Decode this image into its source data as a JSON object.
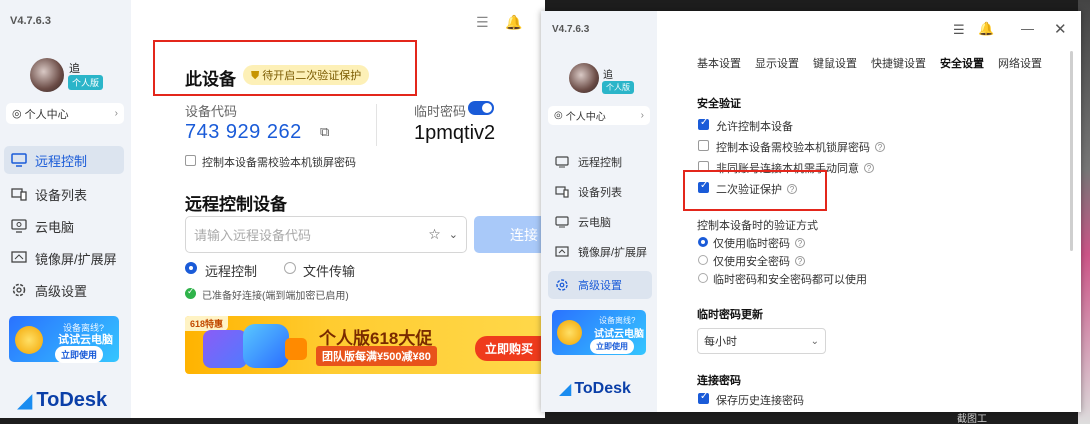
{
  "version": "V4.7.6.3",
  "user": {
    "name": "追",
    "edition": "个人版"
  },
  "profile_center": "个人中心",
  "nav": [
    "远程控制",
    "设备列表",
    "云电脑",
    "镜像屏/扩展屏",
    "高级设置"
  ],
  "promo": {
    "line1": "设备离线?",
    "line2": "试试云电脑",
    "button": "立即使用"
  },
  "brand": "ToDesk",
  "device": {
    "title": "此设备",
    "warn_badge": "待开启二次验证保护",
    "code_label": "设备代码",
    "code": "743 929 262",
    "temp_pw_label": "临时密码",
    "temp_pw": "1pmqtiv2",
    "lock_check": "控制本设备需校验本机锁屏密码"
  },
  "remote": {
    "title": "远程控制设备",
    "placeholder": "请输入远程设备代码",
    "connect": "连接",
    "mode_control": "远程控制",
    "mode_file": "文件传输",
    "ready": "已准备好连接(端到端加密已启用)"
  },
  "banner": {
    "tag": "618特惠",
    "title": "个人版618大促",
    "sub": "团队版每满¥500减¥80",
    "buy": "立即购买"
  },
  "settings": {
    "tabs": [
      "基本设置",
      "显示设置",
      "键鼠设置",
      "快捷键设置",
      "安全设置",
      "网络设置"
    ],
    "active_tab": "安全设置",
    "sec_verify_title": "安全验证",
    "sec_options": [
      "允许控制本设备",
      "控制本设备需校验本机锁屏密码",
      "非同账号连接本机需手动同意",
      "二次验证保护"
    ],
    "method_title": "控制本设备时的验证方式",
    "methods": [
      "仅使用临时密码",
      "仅使用安全密码",
      "临时密码和安全密码都可以使用"
    ],
    "temp_update_title": "临时密码更新",
    "temp_update_value": "每小时",
    "conn_pw_title": "连接密码",
    "save_history": "保存历史连接密码"
  },
  "bottom_hint": "截图工"
}
